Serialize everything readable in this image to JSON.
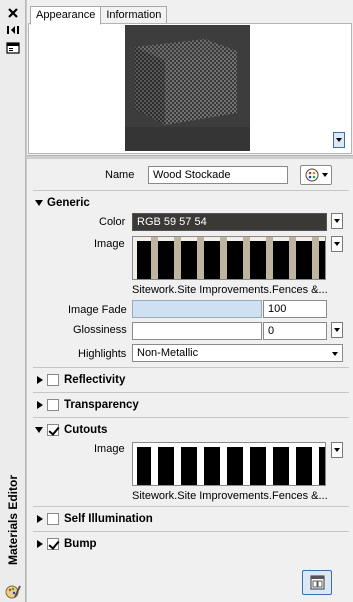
{
  "window": {
    "title": "Materials Editor"
  },
  "strip_icons": [
    "close-icon",
    "auto-hide-icon",
    "properties-icon",
    "materials-editor-icon"
  ],
  "tabs": [
    {
      "label": "Appearance",
      "active": true
    },
    {
      "label": "Information",
      "active": false
    }
  ],
  "name": {
    "label": "Name",
    "value": "Wood Stockade"
  },
  "generic": {
    "title": "Generic",
    "color": {
      "label": "Color",
      "value": "RGB 59 57 54",
      "swatch": "#3b3935"
    },
    "image": {
      "label": "Image",
      "caption": "Sitework.Site Improvements.Fences &..."
    },
    "image_fade": {
      "label": "Image Fade",
      "value": "100",
      "fill": 1.0
    },
    "glossiness": {
      "label": "Glossiness",
      "value": "0"
    },
    "highlights": {
      "label": "Highlights",
      "value": "Non-Metallic"
    }
  },
  "sections": {
    "reflectivity": {
      "title": "Reflectivity",
      "checked": false
    },
    "transparency": {
      "title": "Transparency",
      "checked": false
    },
    "cutouts": {
      "title": "Cutouts",
      "checked": true,
      "image_label": "Image",
      "caption": "Sitework.Site Improvements.Fences &..."
    },
    "self_illumination": {
      "title": "Self Illumination",
      "checked": false
    },
    "bump": {
      "title": "Bump",
      "checked": true
    }
  },
  "colors": {
    "accent": "#3c6fa8",
    "panel": "#f0f0f0",
    "field_highlight": "#cfe0f3"
  }
}
